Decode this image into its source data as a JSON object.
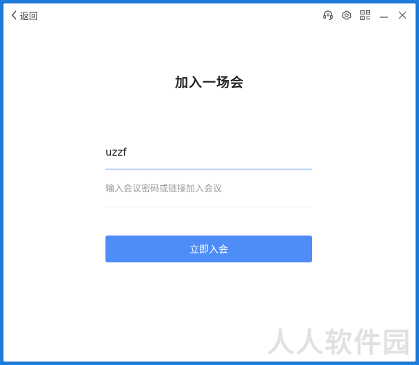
{
  "nav": {
    "back_label": "返回"
  },
  "titlebar": {
    "icons": [
      "headset-icon",
      "settings-icon",
      "qr-code-icon",
      "minimize-icon",
      "close-icon"
    ]
  },
  "main": {
    "title": "加入一场会",
    "name_value": "uzzf",
    "code_placeholder": "输入会议密码或链接加入会议",
    "join_label": "立即入会"
  },
  "watermark": {
    "text": "人人软件园"
  },
  "colors": {
    "accent": "#4e8cf7",
    "active_underline": "#4d8cf5",
    "desktop": "#1f7ee0"
  }
}
